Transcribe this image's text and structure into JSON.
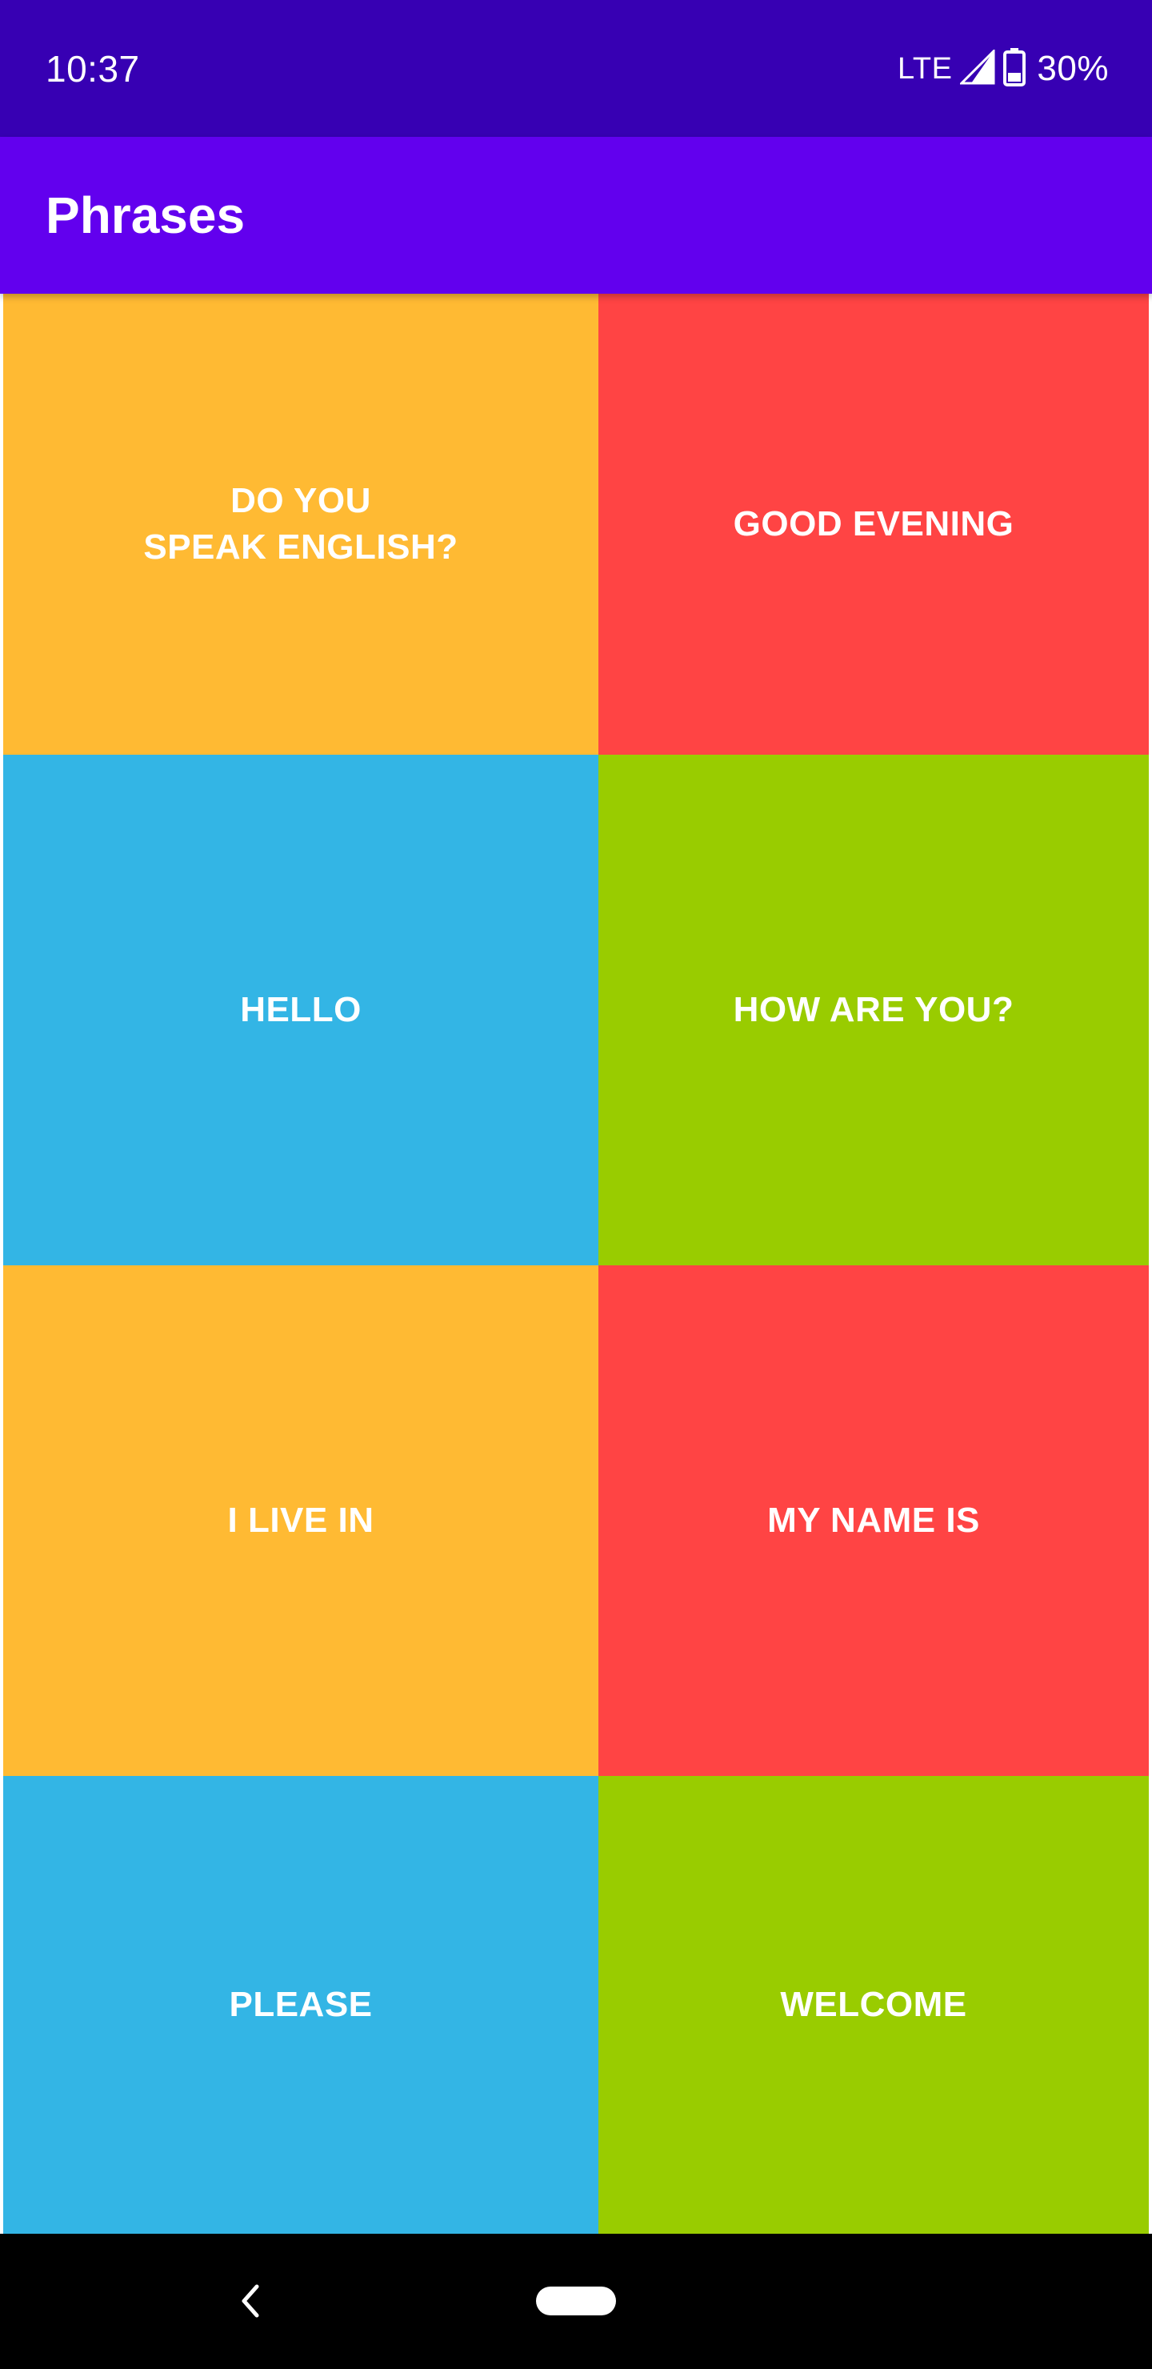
{
  "status_bar": {
    "time": "10:37",
    "network": "LTE",
    "battery": "30%",
    "icons": [
      "signal-icon",
      "battery-icon"
    ]
  },
  "app_bar": {
    "title": "Phrases"
  },
  "phrases": [
    {
      "label": "DO YOU\nSPEAK ENGLISH?",
      "color": "#FFBA33"
    },
    {
      "label": "GOOD EVENING",
      "color": "#FF4444"
    },
    {
      "label": "HELLO",
      "color": "#33B5E5"
    },
    {
      "label": "HOW ARE YOU?",
      "color": "#99CC00"
    },
    {
      "label": "I LIVE IN",
      "color": "#FFBA33"
    },
    {
      "label": "MY NAME IS",
      "color": "#FF4444"
    },
    {
      "label": "PLEASE",
      "color": "#33B5E5"
    },
    {
      "label": "WELCOME",
      "color": "#99CC00"
    }
  ],
  "nav_bar": {
    "icons": [
      "back-icon",
      "home-pill-icon"
    ]
  },
  "colors": {
    "status_bar": "#3700B3",
    "app_bar": "#6200EE",
    "orange": "#FFBA33",
    "red": "#FF4444",
    "blue": "#33B5E5",
    "green": "#99CC00"
  }
}
